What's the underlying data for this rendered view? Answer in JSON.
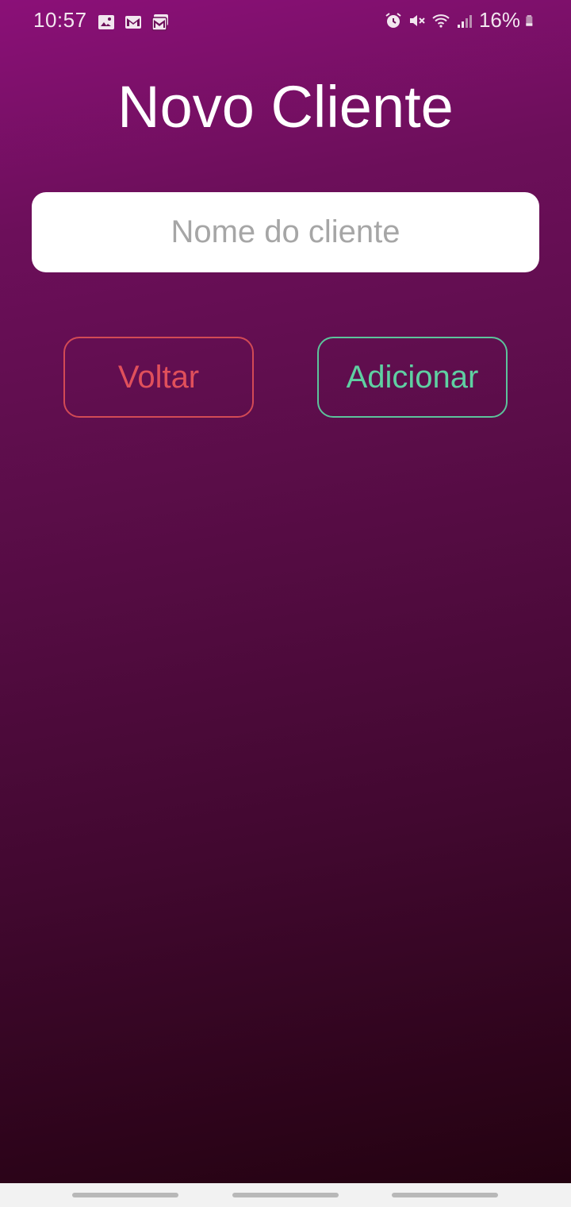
{
  "status_bar": {
    "time": "10:57",
    "battery_percent": "16%",
    "left_icons": [
      "gallery-icon",
      "gmail-icon",
      "gmail-stack-icon"
    ],
    "right_icons": [
      "alarm-icon",
      "mute-icon",
      "wifi-icon",
      "signal-icon",
      "battery-icon"
    ]
  },
  "page": {
    "title": "Novo Cliente"
  },
  "form": {
    "name_placeholder": "Nome do cliente",
    "name_value": ""
  },
  "actions": {
    "back_label": "Voltar",
    "add_label": "Adicionar"
  },
  "colors": {
    "back": "#e0505b",
    "add": "#5fd0a2",
    "background_top": "#8b1078",
    "background_bottom": "#22020f"
  }
}
